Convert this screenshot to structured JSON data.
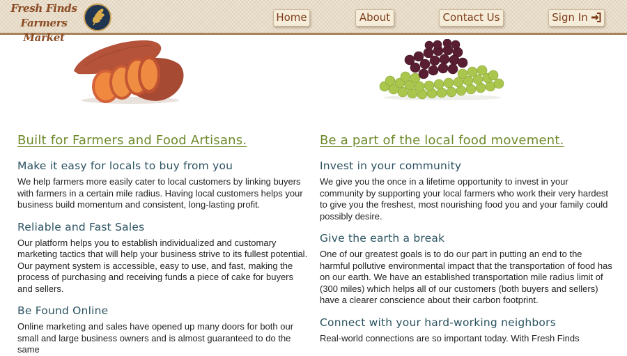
{
  "header": {
    "logo_line1": "Fresh Finds",
    "logo_line2": "Farmers Market",
    "nav": {
      "home": "Home",
      "about": "About",
      "contact": "Contact Us",
      "signin": "Sign In"
    }
  },
  "left": {
    "title": "Built for Farmers and Food Artisans.",
    "sections": [
      {
        "heading": "Make it easy for locals to buy from you",
        "body": "We help farmers more easily cater to local customers by linking buyers with farmers in a certain mile radius. Having local customers helps your business build momentum and consistent, long-lasting profit."
      },
      {
        "heading": "Reliable and Fast Sales",
        "body": "Our platform helps you to establish individualized and customary marketing tactics that will help your business strive to its fullest potential. Our payment system is accessible, easy to use, and fast, making the process of purchasing and receiving funds a piece of cake for buyers and sellers."
      },
      {
        "heading": "Be Found Online",
        "body": "Online marketing and sales have opened up many doors for both our small and large business owners and is almost guaranteed to do the same"
      }
    ]
  },
  "right": {
    "title": "Be a part of the local food movement.",
    "sections": [
      {
        "heading": "Invest in your community",
        "body": "We give you the once in a lifetime opportunity to invest in your community by supporting your local farmers who work their very hardest to give you the freshest, most nourishing food you and your family could possibly desire."
      },
      {
        "heading": "Give the earth a break",
        "body": "One of our greatest goals is to do our part in putting an end to the harmful pollutive environmental impact that the transportation of food has on our earth. We have an established transportation mile radius limit of (300 miles) which helps all of our customers (both buyers and sellers) have a clearer conscience about their carbon footprint."
      },
      {
        "heading": "Connect with your hard-working neighbors",
        "body": "Real-world connections are so important today. With Fresh Finds"
      }
    ]
  },
  "colors": {
    "header_bg": "#efe6d6",
    "nav_text": "#7c3d1a",
    "title_green": "#6d8a2a",
    "heading_teal": "#2b5361"
  },
  "icons": {
    "logo": "wheat-icon",
    "signin": "sign-in-icon"
  }
}
